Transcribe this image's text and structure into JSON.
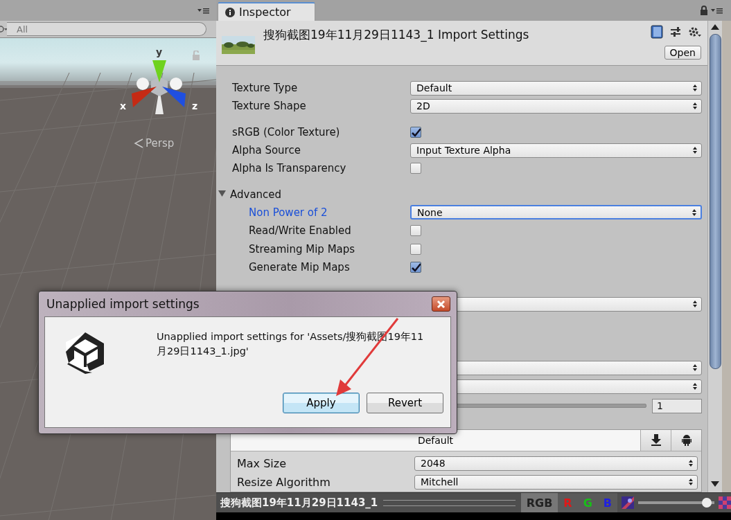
{
  "scene_panel": {
    "search": {
      "placeholder": "All"
    },
    "gizmo": {
      "axes": [
        {
          "label": "y",
          "kind": "up"
        },
        {
          "label": "x",
          "kind": "left"
        },
        {
          "label": "z",
          "kind": "right"
        }
      ]
    },
    "projection": "Persp"
  },
  "inspector": {
    "tab": "Inspector",
    "title": "搜狗截图19年11月29日1143_1 Import Settings",
    "open_button": "Open",
    "fields": [
      {
        "kind": "dropdown",
        "label": "Texture Type",
        "value": "Default"
      },
      {
        "kind": "dropdown",
        "label": "Texture Shape",
        "value": "2D"
      },
      {
        "kind": "checkbox",
        "label": "sRGB (Color Texture)",
        "checked": true
      },
      {
        "kind": "dropdown",
        "label": "Alpha Source",
        "value": "Input Texture Alpha"
      },
      {
        "kind": "checkbox",
        "label": "Alpha Is Transparency",
        "checked": false
      },
      {
        "kind": "section",
        "label": "Advanced",
        "expanded": true,
        "children": [
          {
            "kind": "dropdown",
            "label": "Non Power of 2",
            "value": "None",
            "focused": true
          },
          {
            "kind": "checkbox",
            "label": "Read/Write Enabled",
            "checked": false,
            "focused": false
          },
          {
            "kind": "checkbox",
            "label": "Streaming Mip Maps",
            "checked": false,
            "focused": false
          },
          {
            "kind": "checkbox",
            "label": "Generate Mip Maps",
            "checked": true,
            "focused": false
          }
        ]
      }
    ],
    "covered_fields": [
      {
        "kind": "dropdown"
      },
      {
        "kind": "dropdown"
      },
      {
        "kind": "dropdown"
      },
      {
        "kind": "slider",
        "value": "1"
      }
    ],
    "platform_tab": "Default",
    "platform_fields": [
      {
        "kind": "dropdown",
        "label": "Max Size",
        "value": "2048"
      },
      {
        "kind": "dropdown",
        "label": "Resize Algorithm",
        "value": "Mitchell"
      }
    ]
  },
  "preview_bar": {
    "name": "搜狗截图19年11月29日1143_1",
    "channels": [
      {
        "label": "RGB",
        "selected": true
      },
      {
        "label": "R",
        "selected": false,
        "color": "#e01818"
      },
      {
        "label": "G",
        "selected": false,
        "color": "#18c018"
      },
      {
        "label": "B",
        "selected": false,
        "color": "#2020e0"
      }
    ],
    "mip_slider": {
      "level": 0.9
    }
  },
  "dialog": {
    "title": "Unapplied import settings",
    "message": "Unapplied import settings for 'Assets/搜狗截图19年11月29日1143_1.jpg'",
    "buttons": [
      {
        "label": "Apply",
        "default": true
      },
      {
        "label": "Revert",
        "default": false
      }
    ]
  }
}
